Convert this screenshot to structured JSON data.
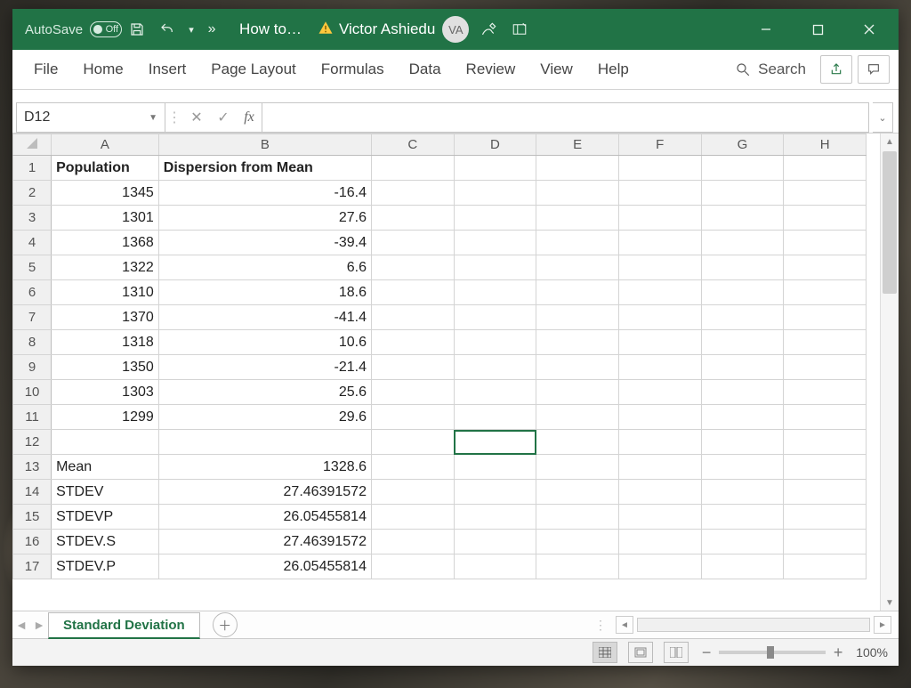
{
  "titlebar": {
    "autosave_label": "AutoSave",
    "autosave_state": "Off",
    "doc_title": "How to…",
    "username": "Victor Ashiedu",
    "user_initials": "VA"
  },
  "ribbon": {
    "tabs": [
      "File",
      "Home",
      "Insert",
      "Page Layout",
      "Formulas",
      "Data",
      "Review",
      "View",
      "Help"
    ],
    "search_label": "Search"
  },
  "formula_bar": {
    "name_box": "D12",
    "fx_label": "fx",
    "formula": ""
  },
  "grid": {
    "columns": [
      "A",
      "B",
      "C",
      "D",
      "E",
      "F",
      "G",
      "H"
    ],
    "col_A_header": "Population",
    "col_B_header": "Dispersion from Mean",
    "rows": [
      {
        "r": "2",
        "A": "1345",
        "B": "-16.4"
      },
      {
        "r": "3",
        "A": "1301",
        "B": "27.6"
      },
      {
        "r": "4",
        "A": "1368",
        "B": "-39.4"
      },
      {
        "r": "5",
        "A": "1322",
        "B": "6.6"
      },
      {
        "r": "6",
        "A": "1310",
        "B": "18.6"
      },
      {
        "r": "7",
        "A": "1370",
        "B": "-41.4"
      },
      {
        "r": "8",
        "A": "1318",
        "B": "10.6"
      },
      {
        "r": "9",
        "A": "1350",
        "B": "-21.4"
      },
      {
        "r": "10",
        "A": "1303",
        "B": "25.6"
      },
      {
        "r": "11",
        "A": "1299",
        "B": "29.6"
      }
    ],
    "stats": [
      {
        "r": "13",
        "label": "Mean",
        "value": "1328.6"
      },
      {
        "r": "14",
        "label": "STDEV",
        "value": "27.46391572"
      },
      {
        "r": "15",
        "label": "STDEVP",
        "value": "26.05455814"
      },
      {
        "r": "16",
        "label": "STDEV.S",
        "value": "27.46391572"
      },
      {
        "r": "17",
        "label": "STDEV.P",
        "value": "26.05455814"
      }
    ],
    "selected_cell": "D12"
  },
  "sheet_tabs": {
    "active": "Standard Deviation"
  },
  "statusbar": {
    "zoom": "100%"
  },
  "chart_data": {
    "type": "table",
    "title": "Population dispersion and standard-deviation summary",
    "series": [
      {
        "name": "Population",
        "values": [
          1345,
          1301,
          1368,
          1322,
          1310,
          1370,
          1318,
          1350,
          1303,
          1299
        ]
      },
      {
        "name": "Dispersion from Mean",
        "values": [
          -16.4,
          27.6,
          -39.4,
          6.6,
          18.6,
          -41.4,
          10.6,
          -21.4,
          25.6,
          29.6
        ]
      }
    ],
    "summary": {
      "Mean": 1328.6,
      "STDEV": 27.46391572,
      "STDEVP": 26.05455814,
      "STDEV.S": 27.46391572,
      "STDEV.P": 26.05455814
    }
  }
}
